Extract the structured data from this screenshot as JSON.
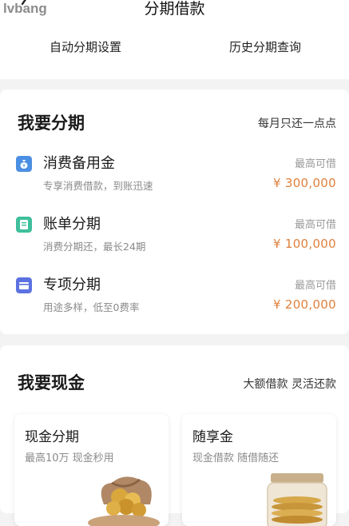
{
  "watermark": "lvbang",
  "header": {
    "title": "分期借款"
  },
  "quick_links": {
    "auto_installment": "自动分期设置",
    "history_query": "历史分期查询"
  },
  "installment_section": {
    "title": "我要分期",
    "subtitle": "每月只还一点点",
    "items": [
      {
        "name": "消费备用金",
        "desc": "专享消费借款，到账迅速",
        "cap_label": "最高可借",
        "amount": "¥ 300,000",
        "icon": "money-bag-icon",
        "icon_color": "#4a8fe3"
      },
      {
        "name": "账单分期",
        "desc": "消费分期还，最长24期",
        "cap_label": "最高可借",
        "amount": "¥ 100,000",
        "icon": "bill-icon",
        "icon_color": "#3fbf9c"
      },
      {
        "name": "专项分期",
        "desc": "用途多样，低至0费率",
        "cap_label": "最高可借",
        "amount": "¥ 200,000",
        "icon": "card-icon",
        "icon_color": "#5b72e0"
      }
    ]
  },
  "cash_section": {
    "title": "我要现金",
    "subtitle": "大额借款 灵活还款",
    "cards": [
      {
        "title": "现金分期",
        "desc": "最高10万 现金秒用"
      },
      {
        "title": "随享金",
        "desc": "现金借款 随借随还"
      }
    ]
  },
  "colors": {
    "amount": "#e0803c",
    "background": "#f3f3f3"
  }
}
